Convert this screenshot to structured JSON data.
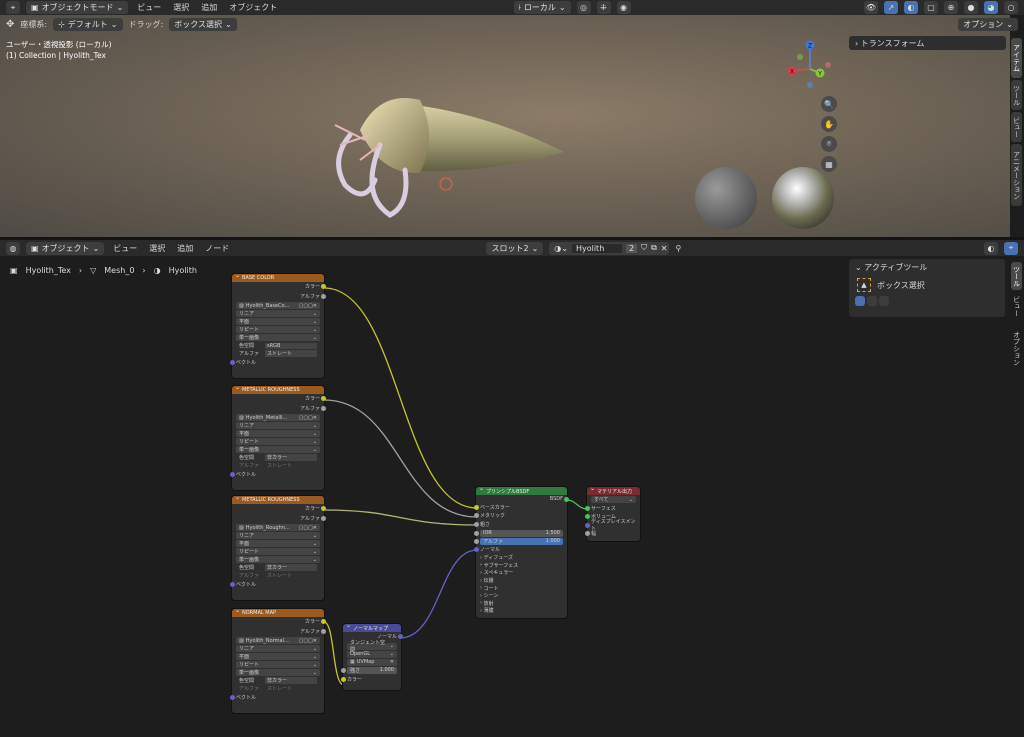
{
  "top_header": {
    "mode": "オブジェクトモード",
    "menus": [
      "ビュー",
      "選択",
      "追加",
      "オブジェクト"
    ],
    "transform": "ローカル",
    "options": "オプション"
  },
  "tool_header": {
    "coord_label": "座標系:",
    "coord_value": "デフォルト",
    "drag_label": "ドラッグ:",
    "drag_value": "ボックス選択"
  },
  "viewport": {
    "info_line1": "ユーザー・透視投影 (ローカル)",
    "info_line2": "(1) Collection | Hyolith_Tex",
    "transform_panel": "トランスフォーム",
    "tabs": [
      "アイテム",
      "ツール",
      "ビュー",
      "アニメーション"
    ],
    "gizmo": {
      "x": "X",
      "y": "Y",
      "z": "Z"
    }
  },
  "node_header": {
    "object": "オブジェクト",
    "menus": [
      "ビュー",
      "選択",
      "追加",
      "ノード"
    ],
    "slot": "スロット2",
    "material": "Hyolith",
    "users": "2"
  },
  "breadcrumb": {
    "items": [
      "Hyolith_Tex",
      "Mesh_0",
      "Hyolith"
    ]
  },
  "tool_panel": {
    "title": "アクティブツール",
    "tool": "ボックス選択",
    "tabs": [
      "ツール",
      "ビュー",
      "オプション"
    ]
  },
  "nodes": {
    "tex1": {
      "title": "BASE COLOR",
      "out_color": "カラー",
      "out_alpha": "アルファ",
      "image": "Hyolith_BaseCo...",
      "interp": "リニア",
      "proj": "平面",
      "ext": "リピート",
      "src": "単一画像",
      "cs_label": "色空間",
      "cs": "sRGB",
      "alpha_label": "アルファ",
      "alpha": "ストレート",
      "in_vec": "ベクトル"
    },
    "tex2": {
      "title": "METALLIC ROUGHNESS",
      "out_color": "カラー",
      "out_alpha": "アルファ",
      "image": "Hyolith_Metalli...",
      "interp": "リニア",
      "proj": "平面",
      "ext": "リピート",
      "src": "単一画像",
      "cs_label": "色空間",
      "cs": "非カラー",
      "alpha_label": "アルファ",
      "alpha": "ストレート",
      "in_vec": "ベクトル"
    },
    "tex3": {
      "title": "METALLIC ROUGHNESS",
      "out_color": "カラー",
      "out_alpha": "アルファ",
      "image": "Hyolith_Roughn...",
      "interp": "リニア",
      "proj": "平面",
      "ext": "リピート",
      "src": "単一画像",
      "cs_label": "色空間",
      "cs": "非カラー",
      "alpha_label": "アルファ",
      "alpha": "ストレート",
      "in_vec": "ベクトル"
    },
    "tex4": {
      "title": "NORMAL MAP",
      "out_color": "カラー",
      "out_alpha": "アルファ",
      "image": "Hyolith_Normal...",
      "interp": "リニア",
      "proj": "平面",
      "ext": "リピート",
      "src": "単一画像",
      "cs_label": "色空間",
      "cs": "非カラー",
      "alpha_label": "アルファ",
      "alpha": "ストレート",
      "in_vec": "ベクトル"
    },
    "bsdf": {
      "title": "プリンシプルBSDF",
      "out": "BSDF",
      "base": "ベースカラー",
      "metal": "メタリック",
      "rough": "粗さ",
      "ior_label": "IOR",
      "ior": "1.500",
      "alpha_label": "アルファ",
      "alpha": "1.000",
      "normal": "ノーマル",
      "sections": [
        "ディフューズ",
        "サブサーフェス",
        "スペキュラー",
        "伝播",
        "コート",
        "シーン",
        "放射",
        "薄膜"
      ]
    },
    "out": {
      "title": "マテリアル出力",
      "target": "すべて",
      "surface": "サーフェス",
      "volume": "ボリューム",
      "disp": "ディスプレイスメント",
      "thick": "幅"
    },
    "nmap": {
      "title": "ノーマルマップ",
      "out": "ノーマル",
      "space": "タンジェント空間",
      "uv_engine": "OpenGL",
      "uv": "UVMap",
      "strength_label": "強さ",
      "strength": "1.000",
      "in_color": "カラー"
    }
  },
  "colors": {
    "accent": "#4772b3",
    "tex_header": "#9b5a20",
    "shader_header": "#2f7a3d",
    "output_header": "#7a2a30",
    "vector_header": "#4a4a9a"
  }
}
